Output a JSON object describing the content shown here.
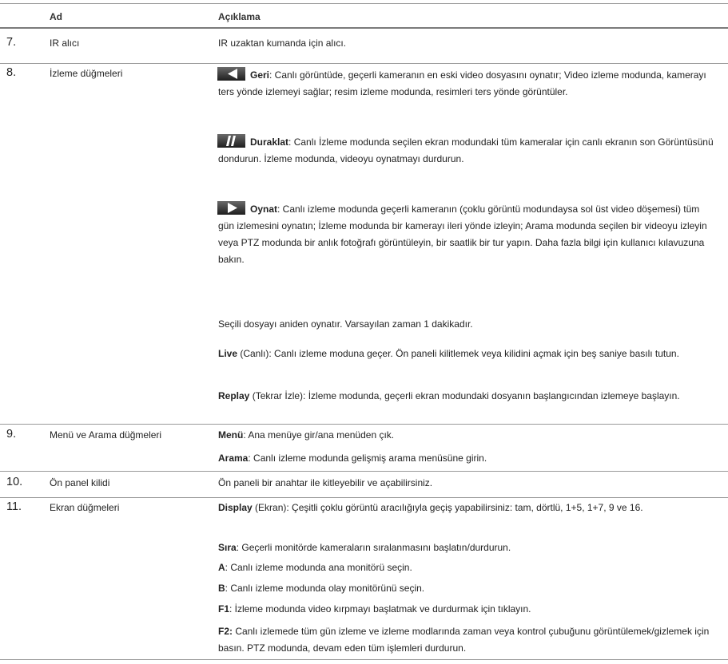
{
  "header": {
    "col_name": "Ad",
    "col_desc": "Açıklama"
  },
  "rows": [
    {
      "num": "7.",
      "name": "IR alıcı",
      "desc": "IR uzaktan kumanda için alıcı."
    },
    {
      "num": "8.",
      "name": "İzleme düğmeleri",
      "items": [
        {
          "icon": "rewind-icon",
          "term": "Geri",
          "text": ": Canlı görüntüde, geçerli kameranın en eski video dosyasını oynatır; Video izleme modunda, kamerayı ters yönde izlemeyi sağlar; resim izleme modunda, resimleri ters yönde görüntüler."
        },
        {
          "icon": "pause-icon",
          "term": "Duraklat",
          "text": ": Canlı İzleme modunda seçilen ekran modundaki tüm kameralar için canlı ekranın son Görüntüsünü dondurun. İzleme modunda, videoyu oynatmayı durdurun."
        },
        {
          "icon": "play-icon",
          "term": "Oynat",
          "text": ": Canlı izleme modunda geçerli kameranın (çoklu görüntü modundaysa sol üst video döşemesi) tüm gün izlemesini oynatın; İzleme modunda bir kamerayı ileri yönde izleyin; Arama modunda seçilen bir videoyu izleyin veya PTZ modunda bir anlık fotoğrafı görüntüleyin, bir saatlik bir tur yapın. Daha fazla bilgi için kullanıcı kılavuzuna bakın."
        },
        {
          "text": "Seçili dosyayı aniden oynatır. Varsayılan zaman 1 dakikadır."
        },
        {
          "term": "Live",
          "text": " (Canlı): Canlı izleme moduna geçer. Ön paneli kilitlemek veya kilidini açmak için beş saniye basılı tutun."
        },
        {
          "term": "Replay",
          "text": " (Tekrar İzle): İzleme modunda, geçerli ekran modundaki dosyanın başlangıcından izlemeye başlayın."
        }
      ]
    },
    {
      "num": "9.",
      "name": "Menü ve Arama düğmeleri",
      "items": [
        {
          "term": "Menü",
          "text": ": Ana menüye gir/ana menüden çık."
        },
        {
          "term": "Arama",
          "text": ": Canlı izleme modunda gelişmiş arama menüsüne girin."
        }
      ]
    },
    {
      "num": "10.",
      "name": "Ön panel kilidi",
      "desc": "Ön paneli bir anahtar ile kitleyebilir ve açabilirsiniz."
    },
    {
      "num": "11.",
      "name": "Ekran düğmeleri",
      "items": [
        {
          "term": "Display",
          "text": " (Ekran): Çeşitli çoklu görüntü aracılığıyla geçiş yapabilirsiniz: tam, dörtlü, 1+5, 1+7, 9 ve 16."
        },
        {
          "term": "Sıra",
          "text": ": Geçerli monitörde kameraların sıralanmasını başlatın/durdurun."
        },
        {
          "term": "A",
          "text": ": Canlı izleme modunda ana monitörü seçin."
        },
        {
          "term": "B",
          "text": ": Canlı izleme modunda olay monitörünü seçin."
        },
        {
          "term": "F1",
          "text": ": İzleme modunda video kırpmayı başlatmak ve durdurmak için tıklayın."
        },
        {
          "term": "F2:",
          "text": " Canlı izlemede tüm gün izleme ve izleme modlarında zaman veya kontrol çubuğunu görüntülemek/gizlemek için basın. PTZ modunda, devam eden tüm işlemleri durdurun."
        }
      ]
    }
  ]
}
